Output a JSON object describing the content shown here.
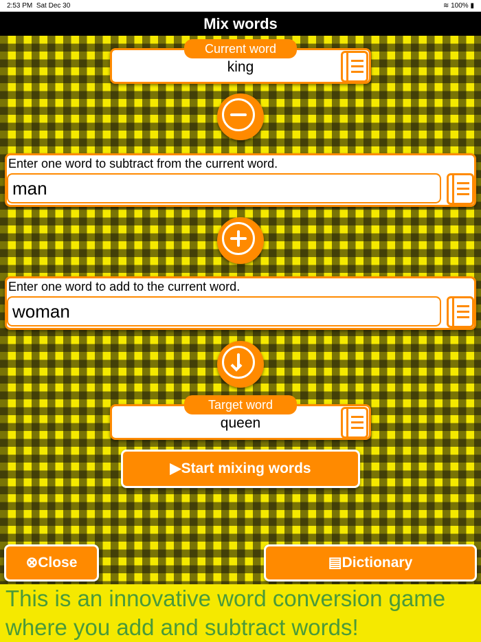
{
  "status_bar": {
    "time": "2:53 PM",
    "date": "Sat Dec 30",
    "battery": "100%"
  },
  "nav": {
    "title": "Mix words"
  },
  "current_word": {
    "label": "Current word",
    "value": "king"
  },
  "subtract": {
    "prompt": "Enter one word to subtract from the current word.",
    "value": "man"
  },
  "add": {
    "prompt": "Enter one word to add to the current word.",
    "value": "woman"
  },
  "target_word": {
    "label": "Target word",
    "value": "queen"
  },
  "buttons": {
    "start": "Start mixing words",
    "close": "Close",
    "dictionary": "Dictionary"
  },
  "footer_text": "This is an innovative word conversion game where you add and subtract words!",
  "colors": {
    "accent": "#ff8a00",
    "background": "#f5e900",
    "footer_text": "#4a9a3a"
  }
}
